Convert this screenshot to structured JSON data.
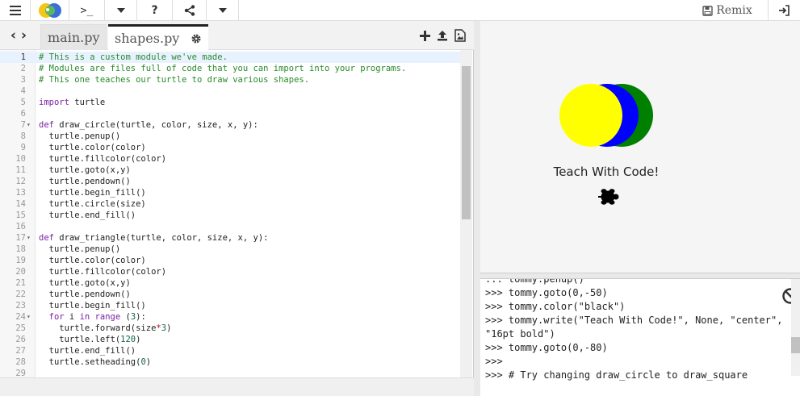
{
  "toolbar": {
    "console_label": ">_",
    "help_label": "?",
    "remix_label": "Remix"
  },
  "editor": {
    "tabs": [
      {
        "label": "main.py",
        "active": false
      },
      {
        "label": "shapes.py",
        "active": true
      }
    ],
    "active_line": 1,
    "lines": [
      {
        "n": "1",
        "fold": "",
        "parts": [
          [
            "c-comment",
            "# This is a custom module we've made."
          ]
        ]
      },
      {
        "n": "2",
        "fold": "",
        "parts": [
          [
            "c-comment",
            "# Modules are files full of code that you can import into your programs."
          ]
        ]
      },
      {
        "n": "3",
        "fold": "",
        "parts": [
          [
            "c-comment",
            "# This one teaches our turtle to draw various shapes."
          ]
        ]
      },
      {
        "n": "4",
        "fold": "",
        "parts": []
      },
      {
        "n": "5",
        "fold": "",
        "parts": [
          [
            "c-kw",
            "import"
          ],
          [
            "c-fn",
            " turtle"
          ]
        ]
      },
      {
        "n": "6",
        "fold": "",
        "parts": []
      },
      {
        "n": "7",
        "fold": "▾",
        "parts": [
          [
            "c-kw",
            "def"
          ],
          [
            "c-fn",
            " draw_circle(turtle, color, size, x, y):"
          ]
        ]
      },
      {
        "n": "8",
        "fold": "",
        "parts": [
          [
            "c-fn",
            "  turtle.penup()"
          ]
        ]
      },
      {
        "n": "9",
        "fold": "",
        "parts": [
          [
            "c-fn",
            "  turtle.color(color)"
          ]
        ]
      },
      {
        "n": "10",
        "fold": "",
        "parts": [
          [
            "c-fn",
            "  turtle.fillcolor(color)"
          ]
        ]
      },
      {
        "n": "11",
        "fold": "",
        "parts": [
          [
            "c-fn",
            "  turtle.goto(x,y)"
          ]
        ]
      },
      {
        "n": "12",
        "fold": "",
        "parts": [
          [
            "c-fn",
            "  turtle.pendown()"
          ]
        ]
      },
      {
        "n": "13",
        "fold": "",
        "parts": [
          [
            "c-fn",
            "  turtle.begin_fill()"
          ]
        ]
      },
      {
        "n": "14",
        "fold": "",
        "parts": [
          [
            "c-fn",
            "  turtle.circle(size)"
          ]
        ]
      },
      {
        "n": "15",
        "fold": "",
        "parts": [
          [
            "c-fn",
            "  turtle.end_fill()"
          ]
        ]
      },
      {
        "n": "16",
        "fold": "",
        "parts": []
      },
      {
        "n": "17",
        "fold": "▾",
        "parts": [
          [
            "c-kw",
            "def"
          ],
          [
            "c-fn",
            " draw_triangle(turtle, color, size, x, y):"
          ]
        ]
      },
      {
        "n": "18",
        "fold": "",
        "parts": [
          [
            "c-fn",
            "  turtle.penup()"
          ]
        ]
      },
      {
        "n": "19",
        "fold": "",
        "parts": [
          [
            "c-fn",
            "  turtle.color(color)"
          ]
        ]
      },
      {
        "n": "20",
        "fold": "",
        "parts": [
          [
            "c-fn",
            "  turtle.fillcolor(color)"
          ]
        ]
      },
      {
        "n": "21",
        "fold": "",
        "parts": [
          [
            "c-fn",
            "  turtle.goto(x,y)"
          ]
        ]
      },
      {
        "n": "22",
        "fold": "",
        "parts": [
          [
            "c-fn",
            "  turtle.pendown()"
          ]
        ]
      },
      {
        "n": "23",
        "fold": "",
        "parts": [
          [
            "c-fn",
            "  turtle.begin_fill()"
          ]
        ]
      },
      {
        "n": "24",
        "fold": "▾",
        "parts": [
          [
            "c-kw",
            "  for"
          ],
          [
            "c-fn",
            " i "
          ],
          [
            "c-kw",
            "in"
          ],
          [
            "c-fn",
            " "
          ],
          [
            "c-kw",
            "range"
          ],
          [
            "c-fn",
            " ("
          ],
          [
            "c-num",
            "3"
          ],
          [
            "c-fn",
            "):"
          ]
        ]
      },
      {
        "n": "25",
        "fold": "",
        "parts": [
          [
            "c-fn",
            "    turtle.forward(size"
          ],
          [
            "c-str",
            "*"
          ],
          [
            "c-num",
            "3"
          ],
          [
            "c-fn",
            ")"
          ]
        ]
      },
      {
        "n": "26",
        "fold": "",
        "parts": [
          [
            "c-fn",
            "    turtle.left("
          ],
          [
            "c-num",
            "120"
          ],
          [
            "c-fn",
            ")"
          ]
        ]
      },
      {
        "n": "27",
        "fold": "",
        "parts": [
          [
            "c-fn",
            "  turtle.end_fill()"
          ]
        ]
      },
      {
        "n": "28",
        "fold": "",
        "parts": [
          [
            "c-fn",
            "  turtle.setheading("
          ],
          [
            "c-num",
            "0"
          ],
          [
            "c-fn",
            ")"
          ]
        ]
      },
      {
        "n": "29",
        "fold": "",
        "parts": []
      }
    ]
  },
  "output": {
    "canvas_text": "Teach With Code!",
    "circle_colors": [
      "#008000",
      "#0000ff",
      "#ffff00"
    ],
    "turtle_color": "#000000"
  },
  "console": {
    "lines": [
      "... tommy.penup()",
      ">>> tommy.goto(0,-50)",
      ">>> tommy.color(\"black\")",
      ">>> tommy.write(\"Teach With Code!\", None, \"center\",",
      "\"16pt bold\")",
      ">>> tommy.goto(0,-80)",
      ">>>",
      ">>> # Try changing draw_circle to draw_square"
    ]
  }
}
